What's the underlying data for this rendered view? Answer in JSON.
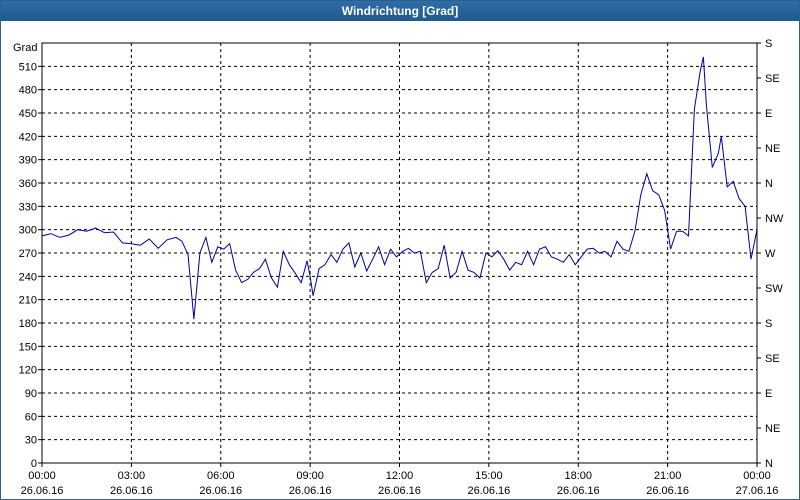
{
  "window": {
    "title": "Windrichtung [Grad]"
  },
  "chart_data": {
    "type": "line",
    "title": "Windrichtung [Grad]",
    "ylabel": "Grad",
    "ylim": [
      0,
      540
    ],
    "yticks": [
      0,
      30,
      60,
      90,
      120,
      150,
      180,
      210,
      240,
      270,
      300,
      330,
      360,
      390,
      420,
      450,
      480,
      510
    ],
    "right_axis_labels": [
      {
        "value": 0,
        "label": "N"
      },
      {
        "value": 45,
        "label": "NE"
      },
      {
        "value": 90,
        "label": "E"
      },
      {
        "value": 135,
        "label": "SE"
      },
      {
        "value": 180,
        "label": "S"
      },
      {
        "value": 225,
        "label": "SW"
      },
      {
        "value": 270,
        "label": "W"
      },
      {
        "value": 315,
        "label": "NW"
      },
      {
        "value": 360,
        "label": "N"
      },
      {
        "value": 405,
        "label": "NE"
      },
      {
        "value": 450,
        "label": "E"
      },
      {
        "value": 495,
        "label": "SE"
      },
      {
        "value": 540,
        "label": "S"
      }
    ],
    "xlim": [
      0,
      24
    ],
    "xticks": [
      {
        "hour": 0,
        "time": "00:00",
        "date": "26.06.16"
      },
      {
        "hour": 3,
        "time": "03:00",
        "date": "26.06.16"
      },
      {
        "hour": 6,
        "time": "06:00",
        "date": "26.06.16"
      },
      {
        "hour": 9,
        "time": "09:00",
        "date": "26.06.16"
      },
      {
        "hour": 12,
        "time": "12:00",
        "date": "26.06.16"
      },
      {
        "hour": 15,
        "time": "15:00",
        "date": "26.06.16"
      },
      {
        "hour": 18,
        "time": "18:00",
        "date": "26.06.16"
      },
      {
        "hour": 21,
        "time": "21:00",
        "date": "26.06.16"
      },
      {
        "hour": 24,
        "time": "00:00",
        "date": "27.06.16"
      }
    ],
    "grid": true,
    "series": [
      {
        "color": "#0000a0",
        "points": [
          [
            0.0,
            292
          ],
          [
            0.3,
            295
          ],
          [
            0.6,
            290
          ],
          [
            0.9,
            293
          ],
          [
            1.2,
            300
          ],
          [
            1.5,
            298
          ],
          [
            1.8,
            302
          ],
          [
            2.1,
            296
          ],
          [
            2.4,
            297
          ],
          [
            2.7,
            283
          ],
          [
            3.0,
            282
          ],
          [
            3.3,
            280
          ],
          [
            3.6,
            288
          ],
          [
            3.9,
            276
          ],
          [
            4.2,
            287
          ],
          [
            4.5,
            290
          ],
          [
            4.7,
            285
          ],
          [
            4.9,
            268
          ],
          [
            5.1,
            185
          ],
          [
            5.3,
            270
          ],
          [
            5.5,
            290
          ],
          [
            5.7,
            258
          ],
          [
            5.9,
            278
          ],
          [
            6.1,
            275
          ],
          [
            6.3,
            282
          ],
          [
            6.5,
            248
          ],
          [
            6.7,
            232
          ],
          [
            6.9,
            236
          ],
          [
            7.1,
            245
          ],
          [
            7.3,
            250
          ],
          [
            7.5,
            262
          ],
          [
            7.7,
            238
          ],
          [
            7.9,
            226
          ],
          [
            8.1,
            272
          ],
          [
            8.3,
            255
          ],
          [
            8.5,
            244
          ],
          [
            8.7,
            232
          ],
          [
            8.9,
            260
          ],
          [
            9.0,
            240
          ],
          [
            9.1,
            215
          ],
          [
            9.3,
            250
          ],
          [
            9.5,
            255
          ],
          [
            9.7,
            268
          ],
          [
            9.9,
            258
          ],
          [
            10.1,
            275
          ],
          [
            10.3,
            283
          ],
          [
            10.5,
            252
          ],
          [
            10.7,
            270
          ],
          [
            10.9,
            247
          ],
          [
            11.1,
            262
          ],
          [
            11.3,
            278
          ],
          [
            11.5,
            255
          ],
          [
            11.7,
            275
          ],
          [
            11.9,
            265
          ],
          [
            12.1,
            272
          ],
          [
            12.3,
            276
          ],
          [
            12.5,
            270
          ],
          [
            12.7,
            272
          ],
          [
            12.9,
            232
          ],
          [
            13.1,
            245
          ],
          [
            13.3,
            250
          ],
          [
            13.5,
            280
          ],
          [
            13.7,
            238
          ],
          [
            13.9,
            245
          ],
          [
            14.1,
            272
          ],
          [
            14.3,
            248
          ],
          [
            14.5,
            245
          ],
          [
            14.7,
            238
          ],
          [
            14.9,
            270
          ],
          [
            15.1,
            265
          ],
          [
            15.3,
            273
          ],
          [
            15.5,
            262
          ],
          [
            15.7,
            248
          ],
          [
            15.9,
            258
          ],
          [
            16.1,
            255
          ],
          [
            16.3,
            272
          ],
          [
            16.5,
            255
          ],
          [
            16.7,
            275
          ],
          [
            16.9,
            278
          ],
          [
            17.1,
            265
          ],
          [
            17.3,
            262
          ],
          [
            17.5,
            258
          ],
          [
            17.7,
            268
          ],
          [
            17.9,
            255
          ],
          [
            18.1,
            265
          ],
          [
            18.3,
            275
          ],
          [
            18.5,
            276
          ],
          [
            18.7,
            270
          ],
          [
            18.9,
            272
          ],
          [
            19.1,
            265
          ],
          [
            19.3,
            285
          ],
          [
            19.5,
            275
          ],
          [
            19.7,
            272
          ],
          [
            19.9,
            298
          ],
          [
            20.1,
            345
          ],
          [
            20.3,
            372
          ],
          [
            20.5,
            350
          ],
          [
            20.7,
            345
          ],
          [
            20.9,
            325
          ],
          [
            21.1,
            275
          ],
          [
            21.3,
            298
          ],
          [
            21.5,
            298
          ],
          [
            21.7,
            292
          ],
          [
            21.9,
            455
          ],
          [
            22.1,
            505
          ],
          [
            22.2,
            522
          ],
          [
            22.3,
            460
          ],
          [
            22.5,
            380
          ],
          [
            22.7,
            398
          ],
          [
            22.8,
            420
          ],
          [
            23.0,
            355
          ],
          [
            23.2,
            362
          ],
          [
            23.4,
            340
          ],
          [
            23.6,
            330
          ],
          [
            23.8,
            262
          ],
          [
            24.0,
            300
          ]
        ]
      }
    ]
  }
}
